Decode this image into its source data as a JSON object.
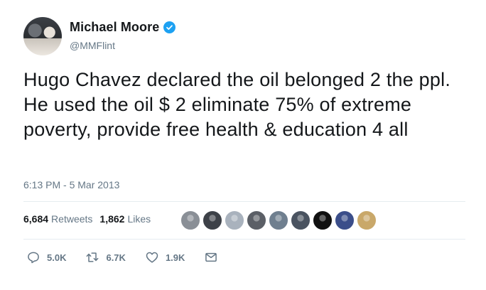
{
  "author": {
    "display_name": "Michael Moore",
    "handle": "@MMFlint",
    "verified": true
  },
  "tweet": {
    "text": "Hugo Chavez declared the oil belonged 2 the ppl. He used the oil $ 2 eliminate 75% of extreme poverty, provide free health & education 4 all",
    "timestamp": "6:13 PM - 5 Mar 2013"
  },
  "stats": {
    "retweets_count": "6,684",
    "retweets_label": "Retweets",
    "likes_count": "1,862",
    "likes_label": "Likes"
  },
  "likers": [
    {
      "color": "#8a8f96"
    },
    {
      "color": "#3d4148"
    },
    {
      "color": "#a9b2bd"
    },
    {
      "color": "#5b5f66"
    },
    {
      "color": "#6f7f8f"
    },
    {
      "color": "#4a5360"
    },
    {
      "color": "#111111"
    },
    {
      "color": "#3b4e8a"
    },
    {
      "color": "#c9a86a"
    }
  ],
  "actions": {
    "reply_count": "5.0K",
    "retweet_count": "6.7K",
    "like_count": "1.9K"
  },
  "colors": {
    "verified_blue": "#1da1f2",
    "muted_text": "#657786",
    "divider": "#e6ecf0"
  }
}
